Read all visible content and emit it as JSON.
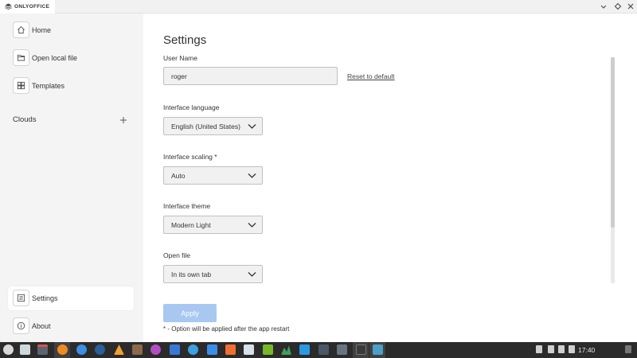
{
  "titlebar": {
    "app_name": "ONLYOFFICE",
    "icons": [
      "minimize-icon",
      "restore-icon",
      "close-icon"
    ]
  },
  "sidebar": {
    "items": [
      {
        "label": "Home",
        "icon": "home-icon"
      },
      {
        "label": "Open local file",
        "icon": "folder-icon"
      },
      {
        "label": "Templates",
        "icon": "templates-icon"
      }
    ],
    "clouds_label": "Clouds",
    "bottom_items": [
      {
        "label": "Settings",
        "icon": "settings-icon",
        "active": true
      },
      {
        "label": "About",
        "icon": "info-icon"
      }
    ]
  },
  "settings": {
    "title": "Settings",
    "user_name_label": "User Name",
    "user_name_value": "roger",
    "reset_label": "Reset to default",
    "language_label": "Interface language",
    "language_value": "English (United States)",
    "scaling_label": "Interface scaling *",
    "scaling_value": "Auto",
    "theme_label": "Interface theme",
    "theme_value": "Modern Light",
    "openfile_label": "Open file",
    "openfile_value": "In its own tab",
    "apply_label": "Apply",
    "note": "* - Option will be applied after the app restart"
  },
  "taskbar": {
    "clock": "17:40"
  },
  "colors": {
    "accent_disabled": "#a8c8f2",
    "sidebar_bg": "#f4f4f4",
    "taskbar_bg": "#2b2b2b"
  }
}
